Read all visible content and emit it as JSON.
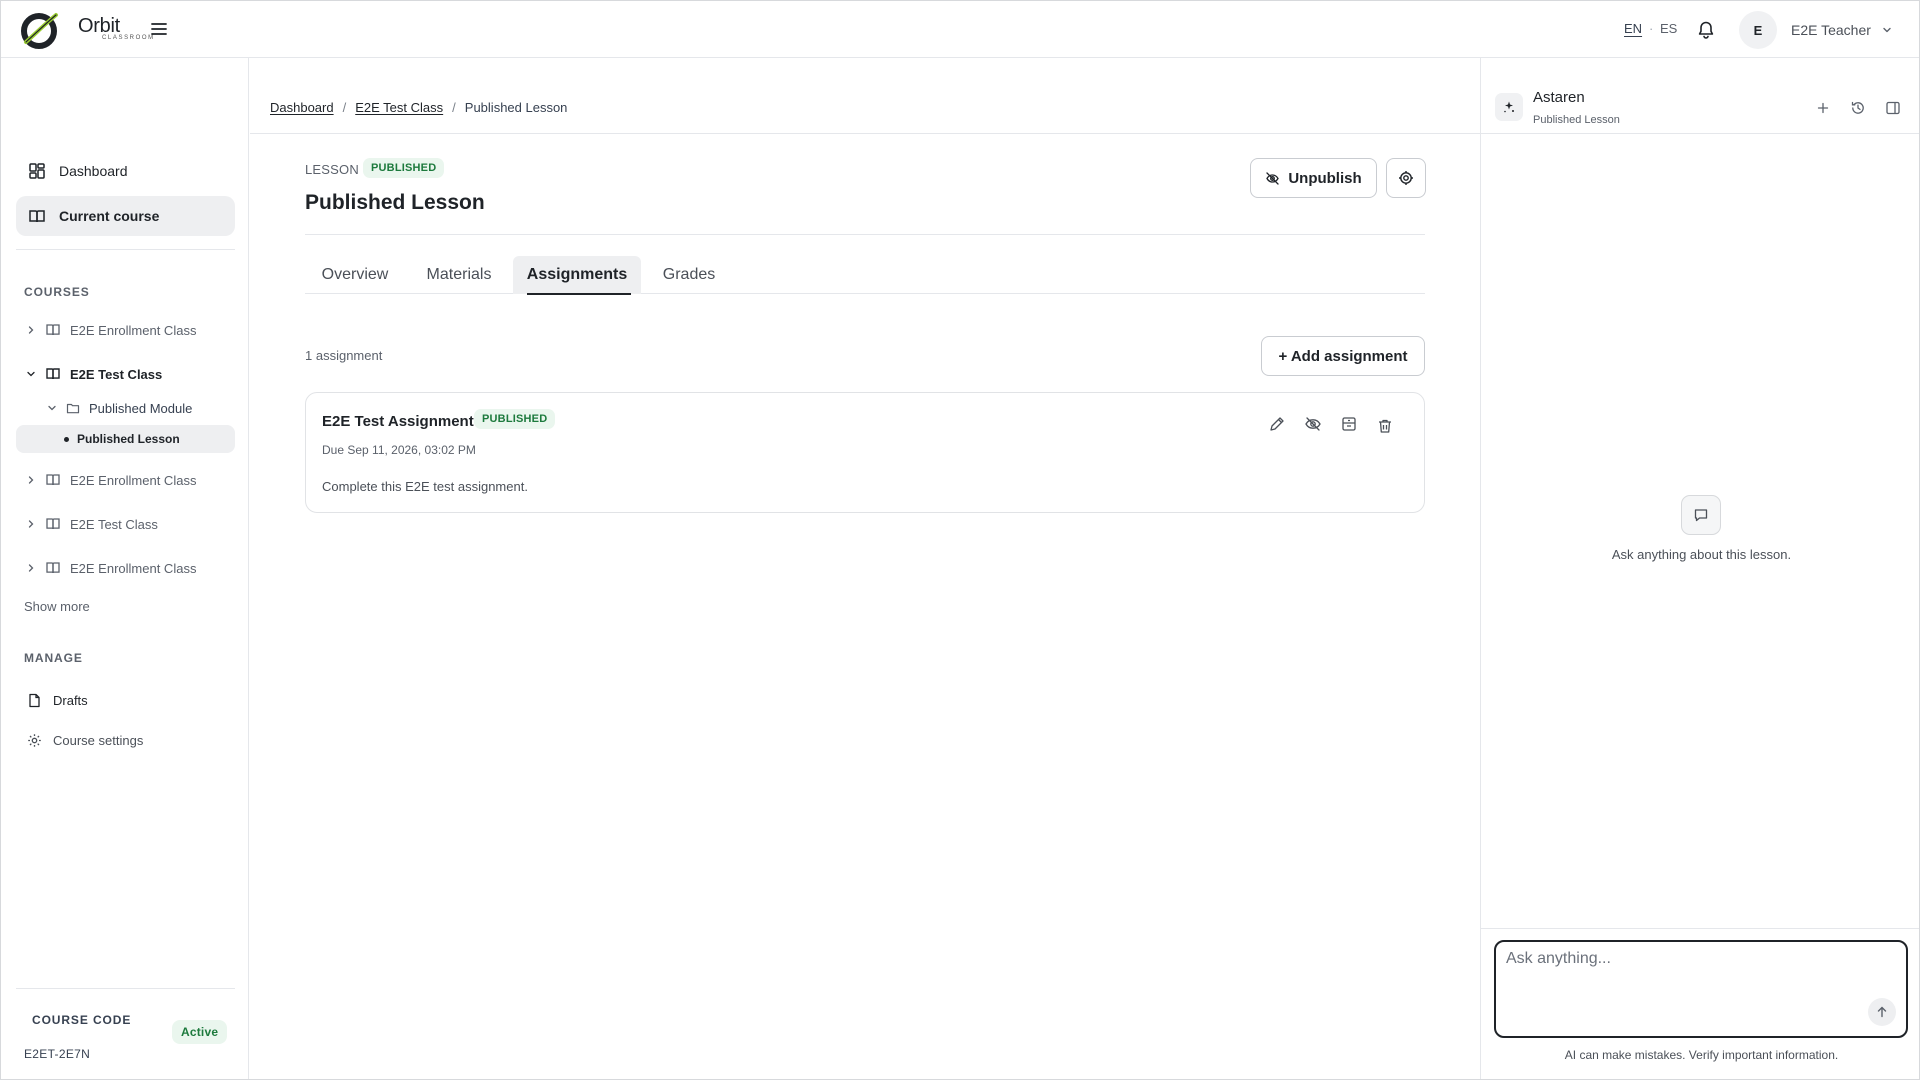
{
  "header": {
    "brand_name": "Orbit",
    "brand_sub": "CLASSROOM",
    "lang_en": "EN",
    "lang_sep": "·",
    "lang_es": "ES",
    "avatar_initial": "E",
    "user_name": "E2E Teacher"
  },
  "sidebar": {
    "nav": [
      {
        "label": "Dashboard",
        "icon": "dashboard-grid-icon"
      },
      {
        "label": "Current course",
        "icon": "book-icon"
      }
    ],
    "courses_label": "COURSES",
    "courses": [
      {
        "label": "E2E Enrollment Class",
        "expanded": false
      },
      {
        "label": "E2E Test Class",
        "expanded": true
      },
      {
        "label": "E2E Enrollment Class",
        "expanded": false
      },
      {
        "label": "E2E Test Class",
        "expanded": false
      },
      {
        "label": "E2E Enrollment Class",
        "expanded": false
      }
    ],
    "module_label": "Published Module",
    "lesson_label": "Published Lesson",
    "show_more": "Show more",
    "manage_label": "MANAGE",
    "drafts": "Drafts",
    "course_settings": "Course settings",
    "course_code_label": "COURSE CODE",
    "course_status": "Active",
    "course_code": "E2ET-2E7N"
  },
  "breadcrumb": {
    "items": [
      "Dashboard",
      "E2E Test Class",
      "Published Lesson"
    ],
    "separator": "/"
  },
  "lesson": {
    "type_label": "LESSON",
    "status": "PUBLISHED",
    "title": "Published Lesson",
    "unpublish_label": "Unpublish"
  },
  "tabs": [
    "Overview",
    "Materials",
    "Assignments",
    "Grades"
  ],
  "active_tab": "Assignments",
  "assignments": {
    "count_label": "1 assignment",
    "add_label": "+ Add assignment",
    "items": [
      {
        "title": "E2E Test Assignment",
        "status": "PUBLISHED",
        "due": "Due Sep 11, 2026, 03:02 PM",
        "description": "Complete this E2E test assignment."
      }
    ]
  },
  "assistant": {
    "name": "Astaren",
    "context": "Published Lesson",
    "empty_text": "Ask anything about this lesson.",
    "input_placeholder": "Ask anything...",
    "disclaimer": "AI can make mistakes. Verify important information."
  },
  "colors": {
    "badge_bg": "#eaf6ee",
    "badge_text": "#1d7a3d",
    "logo_accent": "#9acd32",
    "active_bg": "#eeeff1"
  }
}
